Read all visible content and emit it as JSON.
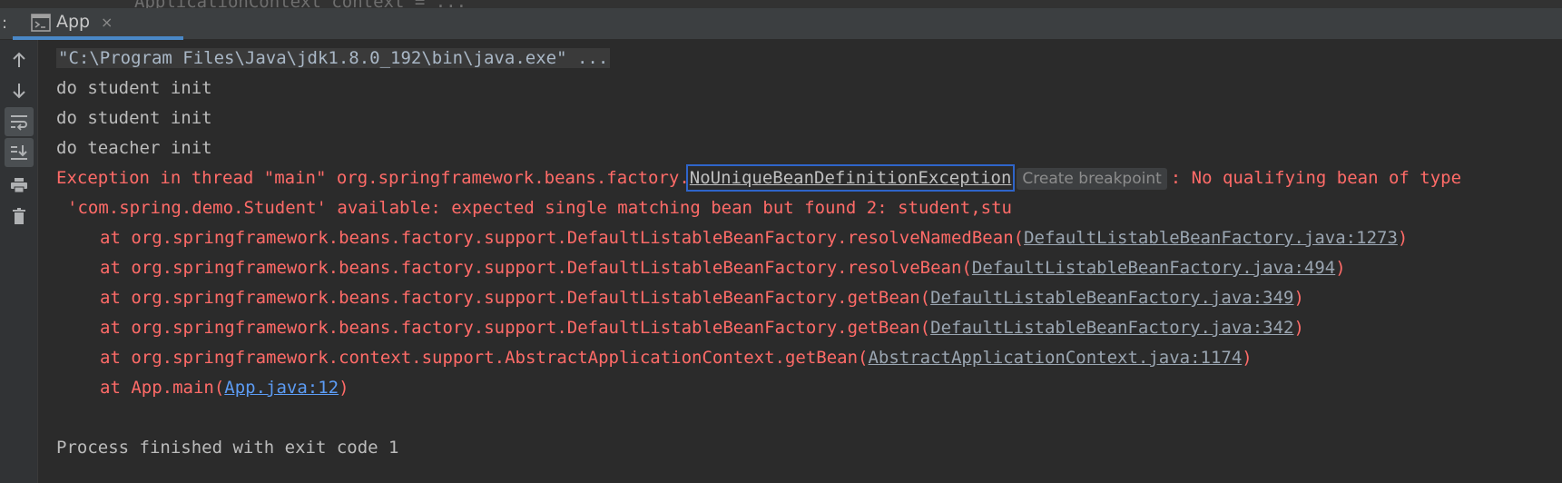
{
  "tab": {
    "label": "App",
    "close": "×"
  },
  "tabbar_prefix": ":",
  "top_fragment": "ApplicationContext context = ...",
  "console": {
    "command": "\"C:\\Program Files\\Java\\jdk1.8.0_192\\bin\\java.exe\" ...",
    "lines": [
      "do student init",
      "do student init",
      "do teacher init"
    ],
    "exception": {
      "prefix": "Exception in thread \"main\" org.springframework.beans.factory.",
      "class_name": "NoUniqueBeanDefinitionException",
      "breakpoint_label": "Create breakpoint",
      "suffix": ": No qualifying bean of type",
      "continuation": "'com.spring.demo.Student' available: expected single matching bean but found 2: student,stu"
    },
    "stack": [
      {
        "text": "at org.springframework.beans.factory.support.DefaultListableBeanFactory.resolveNamedBean(",
        "link": "DefaultListableBeanFactory.java:1273",
        "close": ")"
      },
      {
        "text": "at org.springframework.beans.factory.support.DefaultListableBeanFactory.resolveBean(",
        "link": "DefaultListableBeanFactory.java:494",
        "close": ")"
      },
      {
        "text": "at org.springframework.beans.factory.support.DefaultListableBeanFactory.getBean(",
        "link": "DefaultListableBeanFactory.java:349",
        "close": ")"
      },
      {
        "text": "at org.springframework.beans.factory.support.DefaultListableBeanFactory.getBean(",
        "link": "DefaultListableBeanFactory.java:342",
        "close": ")"
      },
      {
        "text": "at org.springframework.context.support.AbstractApplicationContext.getBean(",
        "link": "AbstractApplicationContext.java:1174",
        "close": ")"
      },
      {
        "text": "at App.main(",
        "link": "App.java:12",
        "close": ")"
      }
    ],
    "exit": "Process finished with exit code 1"
  },
  "toolbar": [
    {
      "name": "up-arrow-icon"
    },
    {
      "name": "down-arrow-icon"
    },
    {
      "name": "soft-wrap-icon"
    },
    {
      "name": "scroll-to-end-icon"
    },
    {
      "name": "print-icon"
    },
    {
      "name": "clear-all-icon"
    }
  ],
  "colors": {
    "background": "#2b2b2b",
    "error": "#ff6b68",
    "link": "#5c9cf5",
    "tab_underline": "#4a88c7",
    "highlight_box": "#2f65ca"
  }
}
